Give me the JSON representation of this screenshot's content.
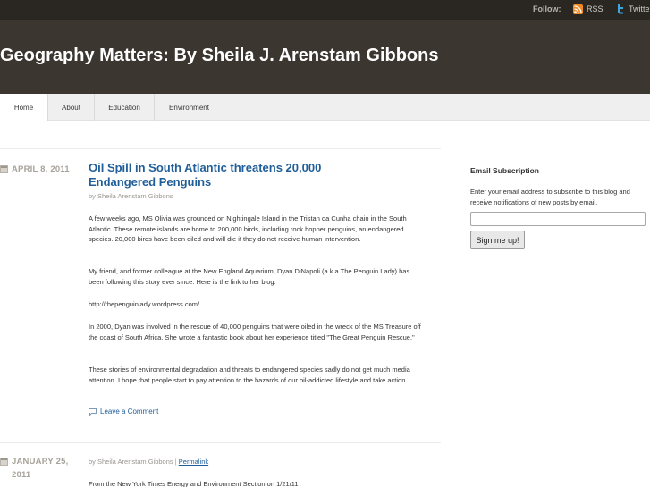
{
  "topbar": {
    "follow_label": "Follow:",
    "rss_label": "RSS",
    "twitter_label": "Twitter",
    "rss_color": "#f08a24",
    "twitter_color": "#3ea6dd"
  },
  "header": {
    "site_title": "Geography Matters: By Sheila J. Arenstam Gibbons"
  },
  "nav": {
    "items": [
      "Home",
      "About",
      "Education",
      "Environment"
    ]
  },
  "posts": [
    {
      "date": "APRIL 8, 2011",
      "title": "Oil Spill in South Atlantic threatens 20,000 Endangered Penguins",
      "byline": "by Sheila Arenstam Gibbons",
      "paragraphs": [
        "A few weeks ago, MS Olivia was grounded on Nightingale Island in the Tristan da Cunha chain in the South Atlantic. These remote islands are home to 200,000 birds, including rock hopper penguins, an endangered species. 20,000 birds have been oiled and will die if they do not receive human intervention.",
        "My friend, and former colleague at the New England Aquarium, Dyan DiNapoli (a.k.a The Penguin Lady) has been following this story ever since. Here is the link to her blog:",
        "http://thepenguinlady.wordpress.com/",
        "In 2000, Dyan was involved in the rescue of 40,000 penguins that were oiled in the wreck of the MS Treasure off the coast of South Africa. She wrote a fantastic book about her experience titled \"The Great Penguin Rescue.\"",
        "These stories of environmental degradation and threats to endangered species sadly do not get much media attention. I hope that people start to pay attention to the hazards of our oil-addicted lifestyle and take action."
      ],
      "comment_link": "Leave a Comment"
    },
    {
      "date": "JANUARY 25, 2011",
      "byline": "by Sheila Arenstam Gibbons",
      "byline_sep": " | ",
      "permalink": "Permalink",
      "first_line": "From the New York Times Energy and Environment Section on 1/21/11"
    }
  ],
  "sidebar": {
    "title": "Email Subscription",
    "text": "Enter your email address to subscribe to this blog and receive notifications of new posts by email.",
    "email_value": "",
    "button_label": "Sign me up!"
  },
  "icons": {
    "rss": "rss-icon",
    "twitter": "twitter-icon",
    "calendar": "calendar-icon",
    "comment": "comment-icon"
  }
}
